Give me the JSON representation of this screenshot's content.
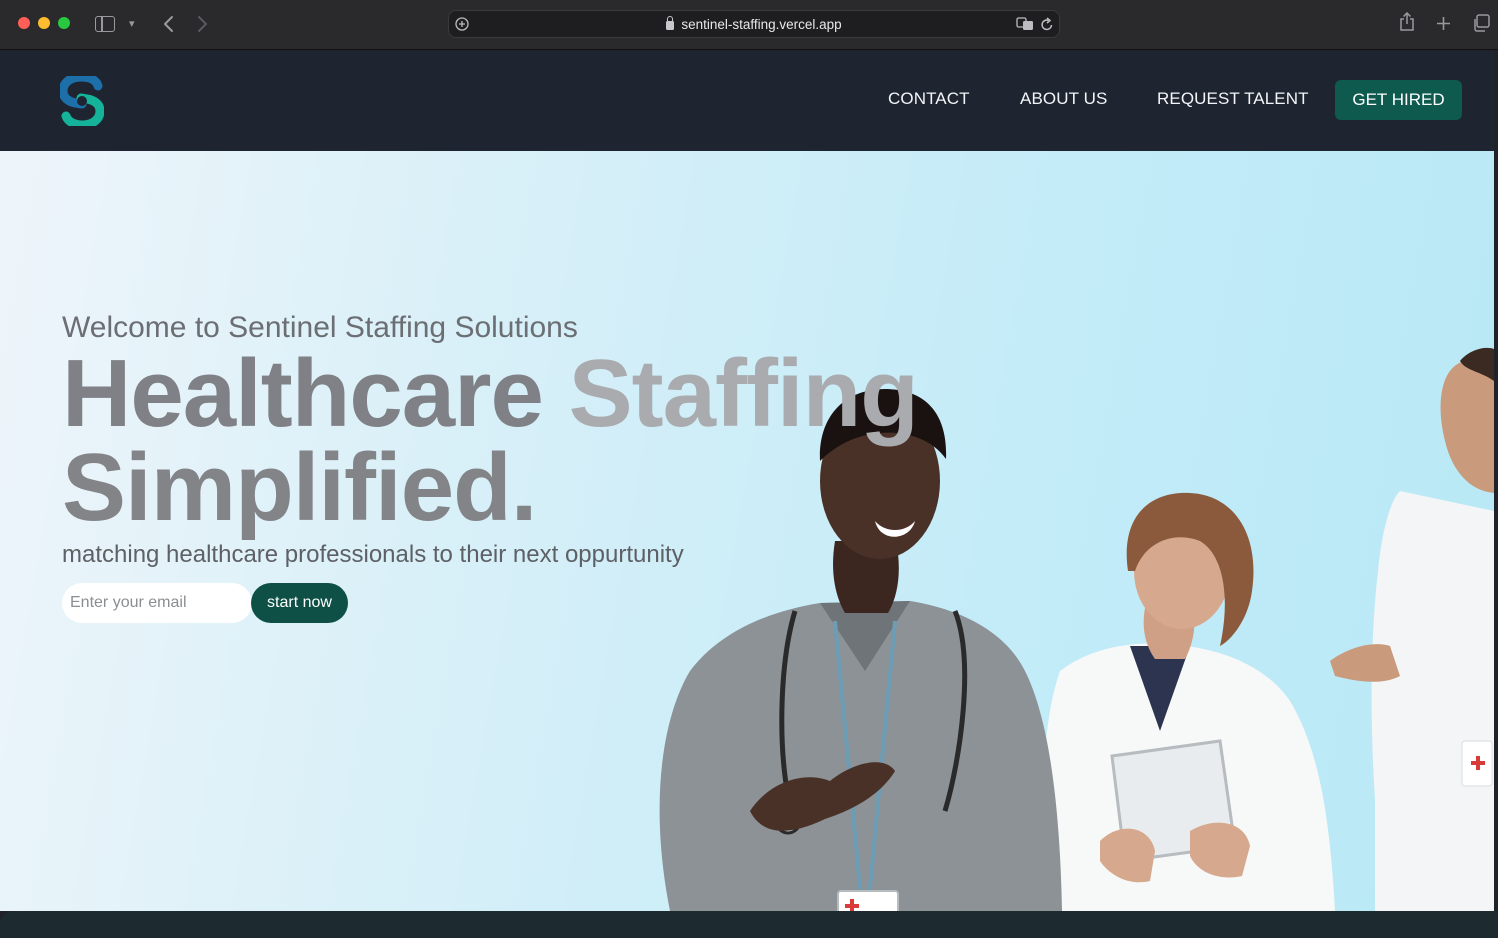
{
  "browser": {
    "url": "sentinel-staffing.vercel.app"
  },
  "nav": {
    "links": [
      "CONTACT",
      "ABOUT US",
      "REQUEST TALENT"
    ],
    "cta": "GET HIRED"
  },
  "hero": {
    "welcome": "Welcome to Sentinel Staffing Solutions",
    "headline_word1": "Healthcare",
    "headline_word2": "Staffing",
    "headline_word3": "Simplified.",
    "subtitle": "matching healthcare professionals to their next oppurtunity",
    "email_placeholder": "Enter your email",
    "button": "start now"
  },
  "colors": {
    "nav_bg": "#1f2530",
    "accent": "#0e5a4e",
    "button": "#0e5045",
    "logo_blue": "#1c6fa8",
    "logo_teal": "#14b39a"
  }
}
